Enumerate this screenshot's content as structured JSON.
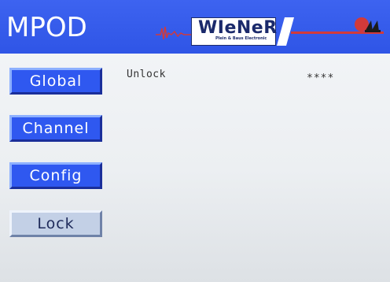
{
  "header": {
    "app_title": "MPOD",
    "logo_text": "WIeNeR",
    "logo_subtext": "Plein & Baus Electronic"
  },
  "sidebar": {
    "items": [
      {
        "label": "Global"
      },
      {
        "label": "Channel"
      },
      {
        "label": "Config"
      },
      {
        "label": "Lock"
      }
    ]
  },
  "main": {
    "unlock_label": "Unlock",
    "password_mask": "****"
  },
  "colors": {
    "header_blue": "#2f55e6",
    "button_blue": "#2f58f0",
    "lock_button_bg": "#c3d0e6",
    "accent_red": "#d23a3a"
  }
}
